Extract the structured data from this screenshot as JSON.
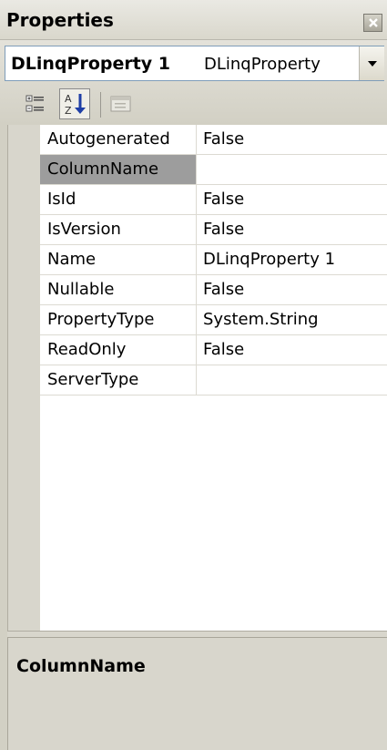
{
  "window": {
    "title": "Properties",
    "close_icon": "close-icon"
  },
  "selector": {
    "object_name": "DLinqProperty 1",
    "object_type": "DLinqProperty",
    "dropdown_icon": "chevron-down-icon"
  },
  "toolbar": {
    "categorized_icon": "categorized-view-icon",
    "alphabetical_icon": "sort-alphabetical-icon",
    "alphabetical_active": true,
    "property_pages_icon": "property-pages-icon"
  },
  "properties": [
    {
      "name": "Autogenerated",
      "value": "False"
    },
    {
      "name": "ColumnName",
      "value": "",
      "selected": true
    },
    {
      "name": "IsId",
      "value": "False"
    },
    {
      "name": "IsVersion",
      "value": "False"
    },
    {
      "name": "Name",
      "value": "DLinqProperty 1"
    },
    {
      "name": "Nullable",
      "value": "False"
    },
    {
      "name": "PropertyType",
      "value": "System.String"
    },
    {
      "name": "ReadOnly",
      "value": "False"
    },
    {
      "name": "ServerType",
      "value": ""
    }
  ],
  "description": {
    "title": "ColumnName",
    "text": ""
  },
  "colors": {
    "selected_row": "#9d9d9d",
    "panel_bg": "#d8d6cc",
    "selector_border": "#7f9db9"
  }
}
